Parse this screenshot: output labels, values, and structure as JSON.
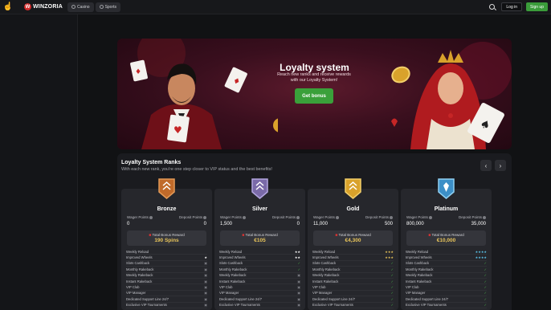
{
  "header": {
    "brand": "WINZORIA",
    "nav": [
      {
        "label": "Casino",
        "icon": "casino-icon"
      },
      {
        "label": "Sports",
        "icon": "sports-icon"
      }
    ],
    "login_label": "Log in",
    "signup_label": "Sign up"
  },
  "banner": {
    "title": "Loyalty system",
    "subtitle": "Reach new ranks and receive rewards with our Loyalty System!",
    "button_label": "Get bonus"
  },
  "ranks_section": {
    "title": "Loyalty System Ranks",
    "subtitle": "With each new rank, you're one step closer to VIP status and the best benefits!",
    "wager_label": "Wager Points",
    "deposit_label": "Deposit Points",
    "reward_label": "Total Bonus Reward",
    "colors": {
      "bronze": "#c06a2a",
      "silver": "#7a6aa8",
      "gold": "#d9a22b",
      "platinum": "#3c8fc7",
      "positive": "#4bb54b"
    },
    "cards": [
      {
        "name": "Bronze",
        "wager": "0",
        "deposit": "0",
        "reward": "190 Spins",
        "perks": [
          {
            "label": "Weekly Reload",
            "value": "",
            "kind": "star-w"
          },
          {
            "label": "Improved Wheels",
            "value": "★",
            "kind": "star-w"
          },
          {
            "label": "Slots Cashback",
            "value": "",
            "kind": "lock"
          },
          {
            "label": "Monthly Rakeback",
            "value": "",
            "kind": "lock"
          },
          {
            "label": "Weekly Rakeback",
            "value": "",
            "kind": "lock"
          },
          {
            "label": "Instant Rakeback",
            "value": "",
            "kind": "lock"
          },
          {
            "label": "VIP Club",
            "value": "",
            "kind": "lock"
          },
          {
            "label": "VIP Manager",
            "value": "",
            "kind": "lock"
          },
          {
            "label": "Dedicated Support Line 24/7",
            "value": "",
            "kind": "lock"
          },
          {
            "label": "Exclusive VIP Tournaments",
            "value": "",
            "kind": "lock"
          }
        ]
      },
      {
        "name": "Silver",
        "wager": "1,500",
        "deposit": "0",
        "reward": "€105",
        "perks": [
          {
            "label": "Weekly Reload",
            "value": "★★",
            "kind": "star-w"
          },
          {
            "label": "Improved Wheels",
            "value": "★★",
            "kind": "star-w"
          },
          {
            "label": "Slots Cashback",
            "value": "",
            "kind": "green"
          },
          {
            "label": "Monthly Rakeback",
            "value": "",
            "kind": "green"
          },
          {
            "label": "Weekly Rakeback",
            "value": "",
            "kind": "lock"
          },
          {
            "label": "Instant Rakeback",
            "value": "",
            "kind": "lock"
          },
          {
            "label": "VIP Club",
            "value": "",
            "kind": "lock"
          },
          {
            "label": "VIP Manager",
            "value": "",
            "kind": "lock"
          },
          {
            "label": "Dedicated Support Line 24/7",
            "value": "",
            "kind": "lock"
          },
          {
            "label": "Exclusive VIP Tournaments",
            "value": "",
            "kind": "lock"
          }
        ]
      },
      {
        "name": "Gold",
        "wager": "11,000",
        "deposit": "500",
        "reward": "€4,300",
        "perks": [
          {
            "label": "Weekly Reload",
            "value": "★★★",
            "kind": "star-g"
          },
          {
            "label": "Improved Wheels",
            "value": "★★★",
            "kind": "star-g"
          },
          {
            "label": "Slots Cashback",
            "value": "",
            "kind": "green"
          },
          {
            "label": "Monthly Rakeback",
            "value": "",
            "kind": "green"
          },
          {
            "label": "Weekly Rakeback",
            "value": "",
            "kind": "green"
          },
          {
            "label": "Instant Rakeback",
            "value": "",
            "kind": "green"
          },
          {
            "label": "VIP Club",
            "value": "",
            "kind": "green"
          },
          {
            "label": "VIP Manager",
            "value": "",
            "kind": "green"
          },
          {
            "label": "Dedicated Support Line 24/7",
            "value": "",
            "kind": "green"
          },
          {
            "label": "Exclusive VIP Tournaments",
            "value": "",
            "kind": "green"
          }
        ]
      },
      {
        "name": "Platinum",
        "wager": "800,000",
        "deposit": "35,000",
        "reward": "€10,000",
        "perks": [
          {
            "label": "Weekly Reload",
            "value": "★★★★",
            "kind": "star-b"
          },
          {
            "label": "Improved Wheels",
            "value": "★★★★",
            "kind": "star-b"
          },
          {
            "label": "Slots Cashback",
            "value": "",
            "kind": "green"
          },
          {
            "label": "Monthly Rakeback",
            "value": "",
            "kind": "green"
          },
          {
            "label": "Weekly Rakeback",
            "value": "",
            "kind": "green"
          },
          {
            "label": "Instant Rakeback",
            "value": "",
            "kind": "green"
          },
          {
            "label": "VIP Club",
            "value": "",
            "kind": "green"
          },
          {
            "label": "VIP Manager",
            "value": "",
            "kind": "green"
          },
          {
            "label": "Dedicated Support Line 24/7",
            "value": "",
            "kind": "green"
          },
          {
            "label": "Exclusive VIP Tournaments",
            "value": "",
            "kind": "green"
          }
        ]
      }
    ]
  }
}
